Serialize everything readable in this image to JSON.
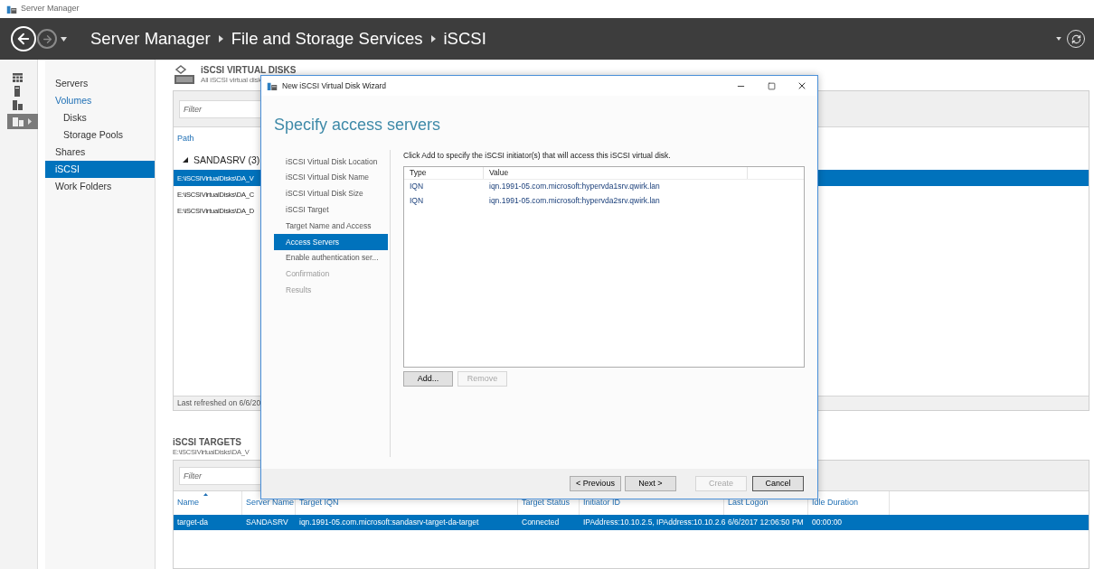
{
  "window": {
    "title": "Server Manager"
  },
  "breadcrumb": [
    "Server Manager",
    "File and Storage Services",
    "iSCSI"
  ],
  "sidebar": {
    "items": [
      {
        "label": "Servers",
        "selected": false
      },
      {
        "label": "Volumes",
        "selected": false,
        "children": [
          {
            "label": "Disks",
            "selected": false
          },
          {
            "label": "Storage Pools",
            "selected": false
          }
        ]
      },
      {
        "label": "Shares",
        "selected": false
      },
      {
        "label": "iSCSI",
        "selected": true
      },
      {
        "label": "Work Folders",
        "selected": false
      }
    ]
  },
  "virtual_disks": {
    "title": "iSCSI VIRTUAL DISKS",
    "subtitle": "All iSCSI virtual disk",
    "filter": {
      "placeholder": "Filter"
    },
    "column": "Path",
    "group": "SANDASRV (3)",
    "rows": [
      {
        "path": "E:\\iSCSIVirtualDisks\\DA_V",
        "selected": true
      },
      {
        "path": "E:\\iSCSIVirtualDisks\\DA_C",
        "selected": false
      },
      {
        "path": "E:\\iSCSIVirtualDisks\\DA_D",
        "selected": false
      }
    ],
    "status": "Last refreshed on 6/6/20"
  },
  "targets": {
    "title": "iSCSI TARGETS",
    "subtitle": "E:\\iSCSIVirtualDisks\\DA_V",
    "filter": {
      "placeholder": "Filter"
    },
    "columns": [
      "Name",
      "Server Name",
      "Target IQN",
      "Target Status",
      "Initiator ID",
      "Last Logon",
      "Idle Duration"
    ],
    "rows": [
      {
        "selected": true,
        "cells": [
          "target-da",
          "SANDASRV",
          "iqn.1991-05.com.microsoft:sandasrv-target-da-target",
          "Connected",
          "IPAddress:10.10.2.5, IPAddress:10.10.2.6",
          "6/6/2017 12:06:50 PM",
          "00:00:00"
        ]
      }
    ]
  },
  "wizard": {
    "title": "New iSCSI Virtual Disk Wizard",
    "heading": "Specify access servers",
    "steps": [
      {
        "label": "iSCSI Virtual Disk Location",
        "selected": false,
        "disabled": false
      },
      {
        "label": "iSCSI Virtual Disk Name",
        "selected": false,
        "disabled": false
      },
      {
        "label": "iSCSI Virtual Disk Size",
        "selected": false,
        "disabled": false
      },
      {
        "label": "iSCSI Target",
        "selected": false,
        "disabled": false
      },
      {
        "label": "Target Name and Access",
        "selected": false,
        "disabled": false
      },
      {
        "label": "Access Servers",
        "selected": true,
        "disabled": false
      },
      {
        "label": "Enable authentication ser...",
        "selected": false,
        "disabled": false
      },
      {
        "label": "Confirmation",
        "selected": false,
        "disabled": true
      },
      {
        "label": "Results",
        "selected": false,
        "disabled": true
      }
    ],
    "instruction": "Click Add to specify the iSCSI initiator(s) that will access this iSCSI virtual disk.",
    "columns": [
      "Type",
      "Value"
    ],
    "rows": [
      {
        "type": "IQN",
        "value": "iqn.1991-05.com.microsoft:hypervda1srv.qwirk.lan"
      },
      {
        "type": "IQN",
        "value": "iqn.1991-05.com.microsoft:hypervda2srv.qwirk.lan"
      }
    ],
    "list_buttons": [
      {
        "label": "Add...",
        "disabled": false
      },
      {
        "label": "Remove",
        "disabled": true
      }
    ],
    "buttons": [
      {
        "label": "< Previous",
        "disabled": false,
        "default": false
      },
      {
        "label": "Next >",
        "disabled": false,
        "default": false
      },
      {
        "label": "Create",
        "disabled": true,
        "default": false
      },
      {
        "label": "Cancel",
        "disabled": false,
        "default": true
      }
    ]
  }
}
